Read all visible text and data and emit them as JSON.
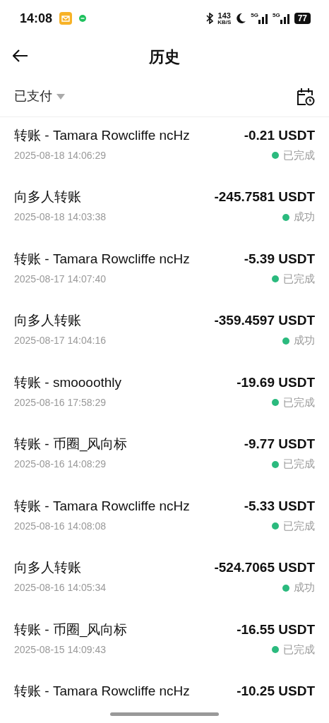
{
  "status_bar": {
    "time": "14:08",
    "speed_value": "143",
    "speed_unit": "KB/S",
    "signal_1": "5G",
    "signal_2": "5G",
    "battery": "77"
  },
  "header": {
    "title": "历史"
  },
  "filter": {
    "label": "已支付"
  },
  "transactions": [
    {
      "title": "转账 - Tamara Rowcliffe ncHz",
      "amount": "-0.21 USDT",
      "date": "2025-08-18 14:06:29",
      "status": "已完成",
      "color": "#2bba7e"
    },
    {
      "title": "向多人转账",
      "amount": "-245.7581 USDT",
      "date": "2025-08-18 14:03:38",
      "status": "成功",
      "color": "#2bba7e"
    },
    {
      "title": "转账 - Tamara Rowcliffe ncHz",
      "amount": "-5.39 USDT",
      "date": "2025-08-17 14:07:40",
      "status": "已完成",
      "color": "#2bba7e"
    },
    {
      "title": "向多人转账",
      "amount": "-359.4597 USDT",
      "date": "2025-08-17 14:04:16",
      "status": "成功",
      "color": "#2bba7e"
    },
    {
      "title": "转账 - smoooothly",
      "amount": "-19.69 USDT",
      "date": "2025-08-16 17:58:29",
      "status": "已完成",
      "color": "#2bba7e"
    },
    {
      "title": "转账 - 币圈_风向标",
      "amount": "-9.77 USDT",
      "date": "2025-08-16 14:08:29",
      "status": "已完成",
      "color": "#2bba7e"
    },
    {
      "title": "转账 - Tamara Rowcliffe ncHz",
      "amount": "-5.33 USDT",
      "date": "2025-08-16 14:08:08",
      "status": "已完成",
      "color": "#2bba7e"
    },
    {
      "title": "向多人转账",
      "amount": "-524.7065 USDT",
      "date": "2025-08-16 14:05:34",
      "status": "成功",
      "color": "#2bba7e"
    },
    {
      "title": "转账 - 币圈_风向标",
      "amount": "-16.55 USDT",
      "date": "2025-08-15 14:09:43",
      "status": "已完成",
      "color": "#2bba7e"
    },
    {
      "title": "转账 - Tamara Rowcliffe ncHz",
      "amount": "-10.25 USDT"
    }
  ]
}
